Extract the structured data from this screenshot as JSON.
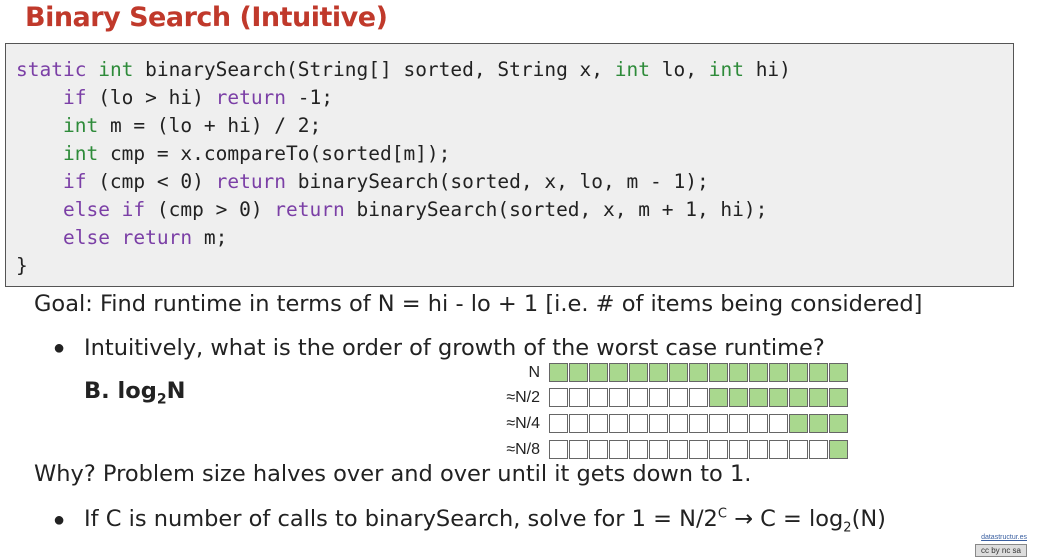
{
  "title": "Binary Search (Intuitive)",
  "code": [
    [
      [
        "kw",
        "static"
      ],
      [
        "t",
        " "
      ],
      [
        "ty",
        "int"
      ],
      [
        "t",
        " binarySearch(String[] sorted, String x, "
      ],
      [
        "ty",
        "int"
      ],
      [
        "t",
        " lo, "
      ],
      [
        "ty",
        "int"
      ],
      [
        "t",
        " hi)"
      ]
    ],
    [
      [
        "t",
        "    "
      ],
      [
        "kw",
        "if"
      ],
      [
        "t",
        " (lo > hi) "
      ],
      [
        "kw",
        "return"
      ],
      [
        "t",
        " -1;"
      ]
    ],
    [
      [
        "t",
        "    "
      ],
      [
        "ty",
        "int"
      ],
      [
        "t",
        " m = (lo + hi) / 2;"
      ]
    ],
    [
      [
        "t",
        "    "
      ],
      [
        "ty",
        "int"
      ],
      [
        "t",
        " cmp = x.compareTo(sorted[m]);"
      ]
    ],
    [
      [
        "t",
        "    "
      ],
      [
        "kw",
        "if"
      ],
      [
        "t",
        " (cmp < 0) "
      ],
      [
        "kw",
        "return"
      ],
      [
        "t",
        " binarySearch(sorted, x, lo, m - 1);"
      ]
    ],
    [
      [
        "t",
        "    "
      ],
      [
        "kw",
        "else if"
      ],
      [
        "t",
        " (cmp > 0) "
      ],
      [
        "kw",
        "return"
      ],
      [
        "t",
        " binarySearch(sorted, x, m + 1, hi);"
      ]
    ],
    [
      [
        "t",
        "    "
      ],
      [
        "kw",
        "else return"
      ],
      [
        "t",
        " m;"
      ]
    ],
    [
      [
        "t",
        "}"
      ]
    ]
  ],
  "goal": "Goal: Find runtime in terms of N = hi - lo + 1  [i.e. # of items being considered]",
  "bullet1": "Intuitively, what is the order of growth of the worst case runtime?",
  "answer_prefix": "B. log",
  "answer_sub": "2",
  "answer_suffix": "N",
  "grid": {
    "total_cells": 15,
    "rows": [
      {
        "label": "N",
        "active": 15
      },
      {
        "label": "≈N/2",
        "active": 7
      },
      {
        "label": "≈N/4",
        "active": 3
      },
      {
        "label": "≈N/8",
        "active": 1
      }
    ]
  },
  "why": "Why? Problem size halves over and over until it gets down to 1.",
  "bullet2_a": "If C is number of calls to binarySearch, solve for 1 = N/2",
  "bullet2_sup": "C",
  "bullet2_b": " → C = log",
  "bullet2_sub": "2",
  "bullet2_c": "(N)",
  "bullet_glyph": "●",
  "footer_link": "datastructur.es",
  "license": "cc by nc sa",
  "colors": {
    "title": "#c0392b",
    "keyword": "#7b3fa6",
    "type": "#2e8b3a",
    "cell_active": "#a9d88e"
  }
}
